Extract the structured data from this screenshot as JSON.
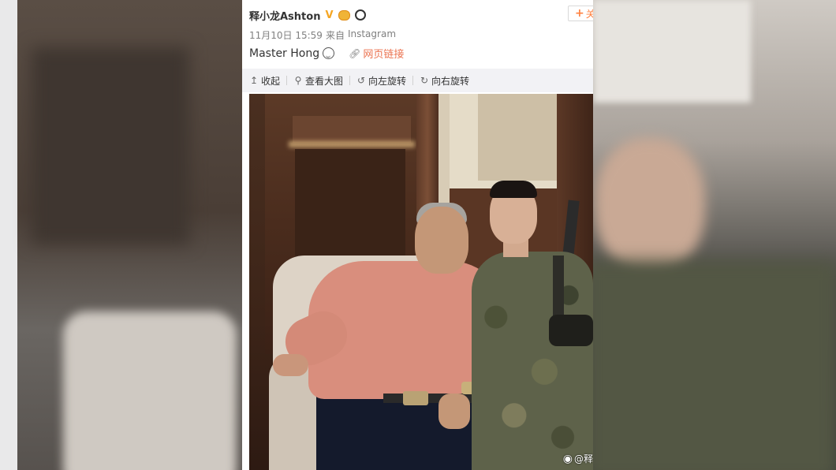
{
  "post": {
    "user_name": "释小龙Ashton",
    "verified_mark": "V",
    "timestamp": "11月10日 15:59",
    "source_prefix": "来自",
    "source": "Instagram",
    "text": "Master Hong",
    "link_label": "网页链接",
    "follow_label": "关"
  },
  "toolbar": {
    "items": [
      {
        "icon": "↥",
        "label": "收起"
      },
      {
        "icon": "⚲",
        "label": "查看大图"
      },
      {
        "icon": "↺",
        "label": "向左旋转"
      },
      {
        "icon": "↻",
        "label": "向右旋转"
      }
    ]
  },
  "photo": {
    "watermark": "@释"
  },
  "icons": {
    "verified": "verified-icon",
    "emoji": "emoji-face-icon",
    "panda": "panda-icon",
    "sticker": "sticker-icon",
    "link": "link-icon",
    "weibo": "weibo-icon"
  },
  "colors": {
    "accent_orange": "#ff8140",
    "link": "#eb7350",
    "toolbar_bg": "#f2f2f5",
    "verified": "#f5a623"
  }
}
